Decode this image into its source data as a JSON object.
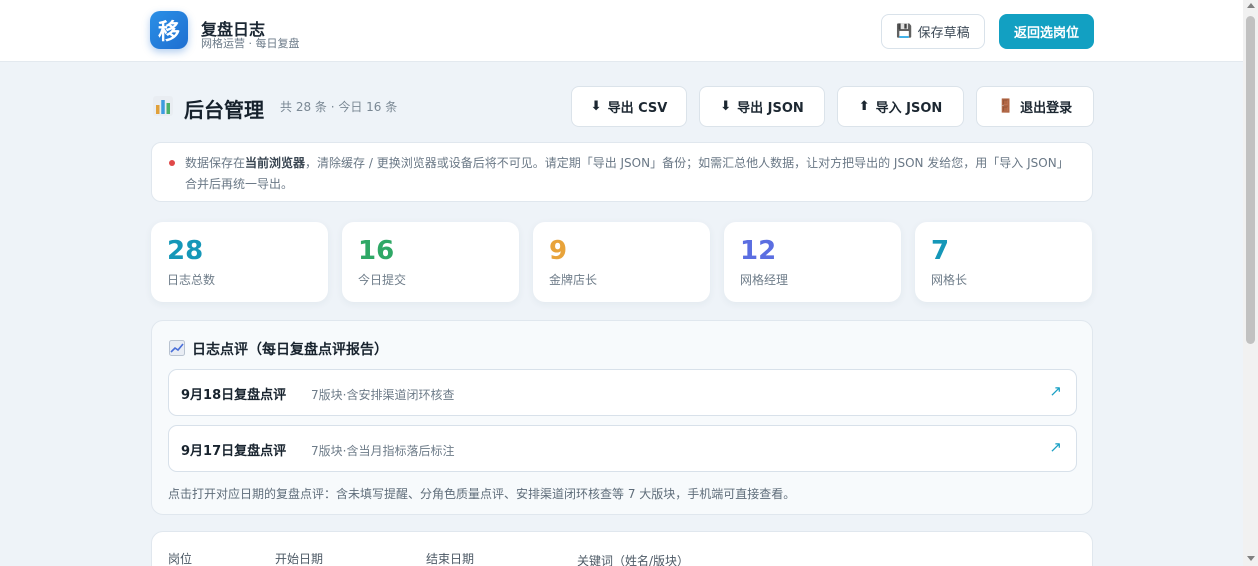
{
  "app": {
    "logo_char": "移",
    "title": "复盘日志",
    "subtitle": "网格运营 · 每日复盘",
    "draft_icon": "💾",
    "draft_label": "保存草稿",
    "back_label": "返回选岗位"
  },
  "header": {
    "icon": "bar-chart-icon",
    "title": "后台管理",
    "count_text": "共 28 条 · 今日 16 条",
    "buttons": [
      {
        "icon": "⬇",
        "label": "导出 CSV"
      },
      {
        "icon": "⬇",
        "label": "导出 JSON"
      },
      {
        "icon": "⬆",
        "label": "导入 JSON"
      },
      {
        "icon": "🚪",
        "label": "退出登录"
      }
    ]
  },
  "notice": {
    "part1": "数据保存在",
    "bold": "当前浏览器",
    "part2": "，清除缓存 / 更换浏览器或设备后将不可见。请定期「导出 JSON」备份；如需汇总他人数据，让对方把导出的 JSON 发给您，用「导入 JSON」合并后再统一导出。"
  },
  "stats": [
    {
      "value": "28",
      "label": "日志总数",
      "color": "#1597b8"
    },
    {
      "value": "16",
      "label": "今日提交",
      "color": "#2fa866"
    },
    {
      "value": "9",
      "label": "金牌店长",
      "color": "#e8a33a"
    },
    {
      "value": "12",
      "label": "网格经理",
      "color": "#5b6ee1"
    },
    {
      "value": "7",
      "label": "网格长",
      "color": "#1597b8"
    }
  ],
  "review": {
    "title": "日志点评（每日复盘点评报告）",
    "items": [
      {
        "date": "9月18日复盘点评",
        "desc": "7版块·含安排渠道闭环核查",
        "arrow": "↗"
      },
      {
        "date": "9月17日复盘点评",
        "desc": "7版块·含当月指标落后标注",
        "arrow": "↗"
      }
    ],
    "footnote": "点击打开对应日期的复盘点评：含未填写提醒、分角色质量点评、安排渠道闭环核查等 7 大版块，手机端可直接查看。"
  },
  "filter": {
    "labels": [
      "岗位",
      "开始日期",
      "结束日期",
      "关键词（姓名/版块）"
    ]
  }
}
